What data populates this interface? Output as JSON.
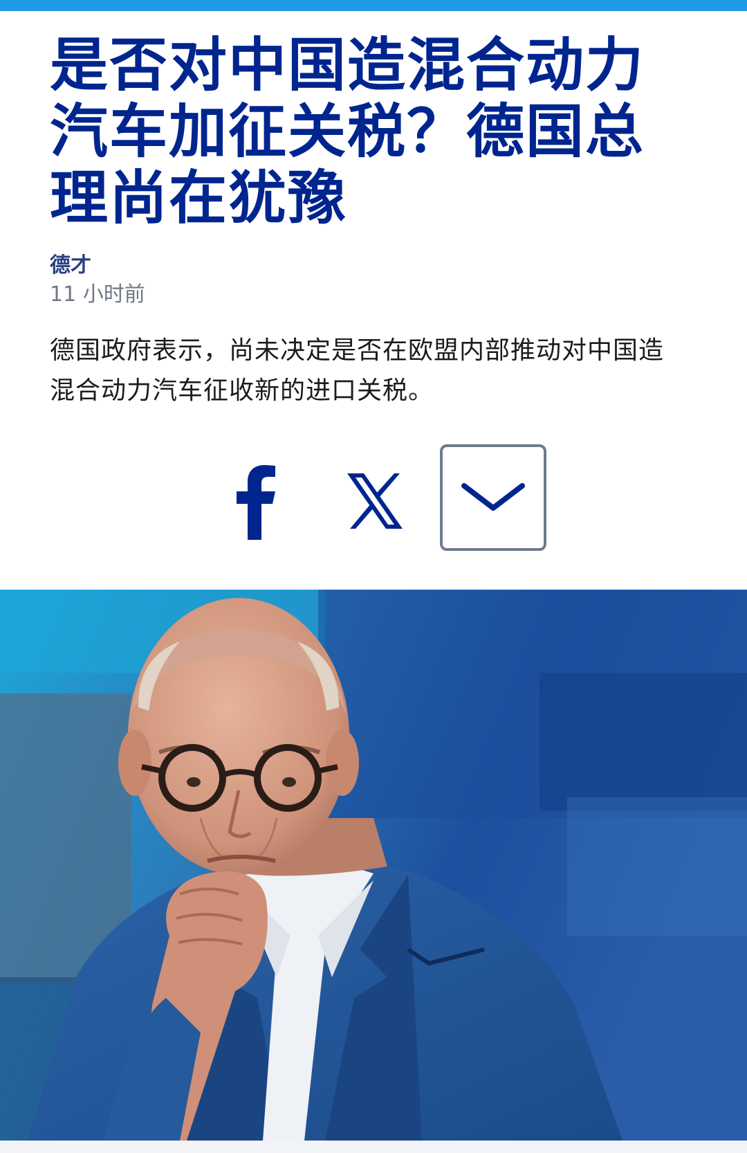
{
  "article": {
    "headline": "是否对中国造混合动力汽车加征关税？德国总理尚在犹豫",
    "author": "德才",
    "timestamp": "11 小时前",
    "lede": "德国政府表示，尚未决定是否在欧盟内部推动对中国造混合动力汽车征收新的进口关税。"
  },
  "share": {
    "icons": [
      "facebook-icon",
      "x-icon",
      "chevron-down-icon"
    ]
  },
  "colors": {
    "brand_blue": "#00258f",
    "top_bar": "#1e9be6",
    "expand_border": "#6e7a8e"
  }
}
